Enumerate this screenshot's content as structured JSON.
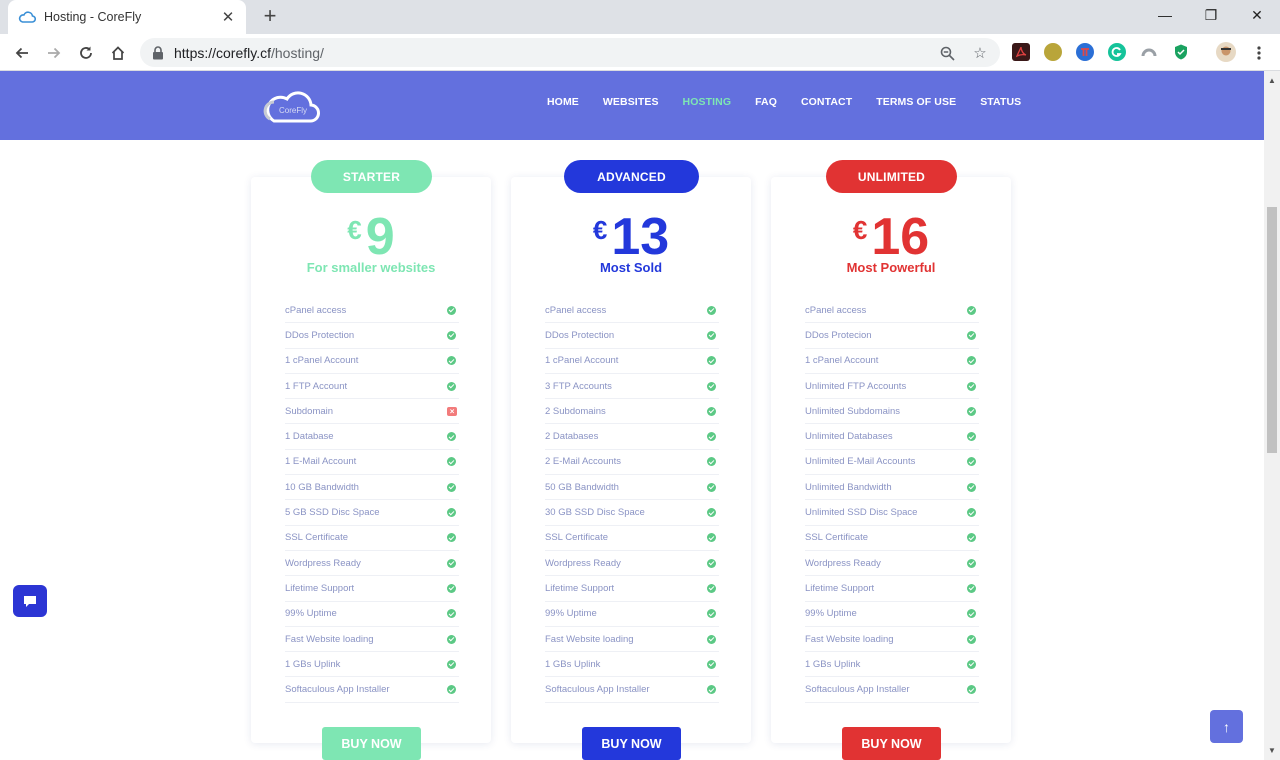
{
  "browser": {
    "tab_title": "Hosting - CoreFly",
    "new_tab": "+",
    "url_host": "https://corefly.cf",
    "url_path": "/hosting/",
    "window_controls": {
      "minimize": "—",
      "restore": "❐",
      "close": "✕"
    },
    "extensions": [
      "pdf-extension-icon",
      "globe-extension-icon",
      "pi-extension-icon",
      "grammarly-icon",
      "cloud-extension-icon",
      "shield-extension-icon",
      "avatar-icon"
    ]
  },
  "site": {
    "logo_text": "CoreFly",
    "nav": [
      {
        "label": "HOME",
        "active": false
      },
      {
        "label": "WEBSITES",
        "active": false
      },
      {
        "label": "HOSTING",
        "active": true
      },
      {
        "label": "FAQ",
        "active": false
      },
      {
        "label": "CONTACT",
        "active": false
      },
      {
        "label": "TERMS OF USE",
        "active": false
      },
      {
        "label": "STATUS",
        "active": false
      }
    ],
    "colors": {
      "header": "#6370de",
      "nav_active": "#7ee6b3",
      "starter": "#7ee6b3",
      "advanced": "#2338db",
      "unlimited": "#e13333"
    }
  },
  "plans": [
    {
      "badge": "STARTER",
      "currency": "€",
      "price": "9",
      "subtitle": "For smaller websites",
      "buy_label": "BUY NOW",
      "features": [
        {
          "label": "cPanel access",
          "ok": true
        },
        {
          "label": "DDos Protection",
          "ok": true
        },
        {
          "label": "1 cPanel Account",
          "ok": true
        },
        {
          "label": "1 FTP Account",
          "ok": true
        },
        {
          "label": "Subdomain",
          "ok": false
        },
        {
          "label": "1 Database",
          "ok": true
        },
        {
          "label": "1 E-Mail Account",
          "ok": true
        },
        {
          "label": "10 GB Bandwidth",
          "ok": true
        },
        {
          "label": "5 GB SSD Disc Space",
          "ok": true
        },
        {
          "label": "SSL Certificate",
          "ok": true
        },
        {
          "label": "Wordpress Ready",
          "ok": true
        },
        {
          "label": "Lifetime Support",
          "ok": true
        },
        {
          "label": "99% Uptime",
          "ok": true
        },
        {
          "label": "Fast Website loading",
          "ok": true
        },
        {
          "label": "1 GBs Uplink",
          "ok": true
        },
        {
          "label": "Softaculous App Installer",
          "ok": true
        }
      ]
    },
    {
      "badge": "ADVANCED",
      "currency": "€",
      "price": "13",
      "subtitle": "Most Sold",
      "buy_label": "BUY NOW",
      "features": [
        {
          "label": "cPanel access",
          "ok": true
        },
        {
          "label": "DDos Protection",
          "ok": true
        },
        {
          "label": "1 cPanel Account",
          "ok": true
        },
        {
          "label": "3 FTP Accounts",
          "ok": true
        },
        {
          "label": "2 Subdomains",
          "ok": true
        },
        {
          "label": "2 Databases",
          "ok": true
        },
        {
          "label": "2 E-Mail Accounts",
          "ok": true
        },
        {
          "label": "50 GB Bandwidth",
          "ok": true
        },
        {
          "label": "30 GB SSD Disc Space",
          "ok": true
        },
        {
          "label": "SSL Certificate",
          "ok": true
        },
        {
          "label": "Wordpress Ready",
          "ok": true
        },
        {
          "label": "Lifetime Support",
          "ok": true
        },
        {
          "label": "99% Uptime",
          "ok": true
        },
        {
          "label": "Fast Website loading",
          "ok": true
        },
        {
          "label": "1 GBs Uplink",
          "ok": true
        },
        {
          "label": "Softaculous App Installer",
          "ok": true
        }
      ]
    },
    {
      "badge": "UNLIMITED",
      "currency": "€",
      "price": "16",
      "subtitle": "Most Powerful",
      "buy_label": "BUY NOW",
      "features": [
        {
          "label": "cPanel access",
          "ok": true
        },
        {
          "label": "DDos Protecion",
          "ok": true
        },
        {
          "label": "1 cPanel Account",
          "ok": true
        },
        {
          "label": "Unlimited FTP Accounts",
          "ok": true
        },
        {
          "label": "Unlimited Subdomains",
          "ok": true
        },
        {
          "label": "Unlimited Databases",
          "ok": true
        },
        {
          "label": "Unlimited E-Mail Accounts",
          "ok": true
        },
        {
          "label": "Unlimited Bandwidth",
          "ok": true
        },
        {
          "label": "Unlimited SSD Disc Space",
          "ok": true
        },
        {
          "label": "SSL Certificate",
          "ok": true
        },
        {
          "label": "Wordpress Ready",
          "ok": true
        },
        {
          "label": "Lifetime Support",
          "ok": true
        },
        {
          "label": "99% Uptime",
          "ok": true
        },
        {
          "label": "Fast Website loading",
          "ok": true
        },
        {
          "label": "1 GBs Uplink",
          "ok": true
        },
        {
          "label": "Softaculous App Installer",
          "ok": true
        }
      ]
    }
  ],
  "floating": {
    "back_to_top": "↑"
  }
}
